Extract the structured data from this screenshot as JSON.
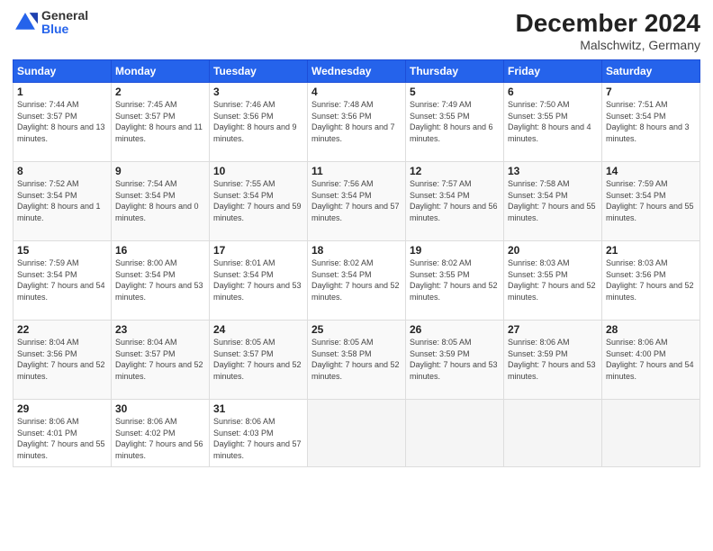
{
  "header": {
    "logo_general": "General",
    "logo_blue": "Blue",
    "month_title": "December 2024",
    "location": "Malschwitz, Germany"
  },
  "days_of_week": [
    "Sunday",
    "Monday",
    "Tuesday",
    "Wednesday",
    "Thursday",
    "Friday",
    "Saturday"
  ],
  "weeks": [
    [
      {
        "day": "1",
        "sunrise": "7:44 AM",
        "sunset": "3:57 PM",
        "daylight": "8 hours and 13 minutes."
      },
      {
        "day": "2",
        "sunrise": "7:45 AM",
        "sunset": "3:57 PM",
        "daylight": "8 hours and 11 minutes."
      },
      {
        "day": "3",
        "sunrise": "7:46 AM",
        "sunset": "3:56 PM",
        "daylight": "8 hours and 9 minutes."
      },
      {
        "day": "4",
        "sunrise": "7:48 AM",
        "sunset": "3:56 PM",
        "daylight": "8 hours and 7 minutes."
      },
      {
        "day": "5",
        "sunrise": "7:49 AM",
        "sunset": "3:55 PM",
        "daylight": "8 hours and 6 minutes."
      },
      {
        "day": "6",
        "sunrise": "7:50 AM",
        "sunset": "3:55 PM",
        "daylight": "8 hours and 4 minutes."
      },
      {
        "day": "7",
        "sunrise": "7:51 AM",
        "sunset": "3:54 PM",
        "daylight": "8 hours and 3 minutes."
      }
    ],
    [
      {
        "day": "8",
        "sunrise": "7:52 AM",
        "sunset": "3:54 PM",
        "daylight": "8 hours and 1 minute."
      },
      {
        "day": "9",
        "sunrise": "7:54 AM",
        "sunset": "3:54 PM",
        "daylight": "8 hours and 0 minutes."
      },
      {
        "day": "10",
        "sunrise": "7:55 AM",
        "sunset": "3:54 PM",
        "daylight": "7 hours and 59 minutes."
      },
      {
        "day": "11",
        "sunrise": "7:56 AM",
        "sunset": "3:54 PM",
        "daylight": "7 hours and 57 minutes."
      },
      {
        "day": "12",
        "sunrise": "7:57 AM",
        "sunset": "3:54 PM",
        "daylight": "7 hours and 56 minutes."
      },
      {
        "day": "13",
        "sunrise": "7:58 AM",
        "sunset": "3:54 PM",
        "daylight": "7 hours and 55 minutes."
      },
      {
        "day": "14",
        "sunrise": "7:59 AM",
        "sunset": "3:54 PM",
        "daylight": "7 hours and 55 minutes."
      }
    ],
    [
      {
        "day": "15",
        "sunrise": "7:59 AM",
        "sunset": "3:54 PM",
        "daylight": "7 hours and 54 minutes."
      },
      {
        "day": "16",
        "sunrise": "8:00 AM",
        "sunset": "3:54 PM",
        "daylight": "7 hours and 53 minutes."
      },
      {
        "day": "17",
        "sunrise": "8:01 AM",
        "sunset": "3:54 PM",
        "daylight": "7 hours and 53 minutes."
      },
      {
        "day": "18",
        "sunrise": "8:02 AM",
        "sunset": "3:54 PM",
        "daylight": "7 hours and 52 minutes."
      },
      {
        "day": "19",
        "sunrise": "8:02 AM",
        "sunset": "3:55 PM",
        "daylight": "7 hours and 52 minutes."
      },
      {
        "day": "20",
        "sunrise": "8:03 AM",
        "sunset": "3:55 PM",
        "daylight": "7 hours and 52 minutes."
      },
      {
        "day": "21",
        "sunrise": "8:03 AM",
        "sunset": "3:56 PM",
        "daylight": "7 hours and 52 minutes."
      }
    ],
    [
      {
        "day": "22",
        "sunrise": "8:04 AM",
        "sunset": "3:56 PM",
        "daylight": "7 hours and 52 minutes."
      },
      {
        "day": "23",
        "sunrise": "8:04 AM",
        "sunset": "3:57 PM",
        "daylight": "7 hours and 52 minutes."
      },
      {
        "day": "24",
        "sunrise": "8:05 AM",
        "sunset": "3:57 PM",
        "daylight": "7 hours and 52 minutes."
      },
      {
        "day": "25",
        "sunrise": "8:05 AM",
        "sunset": "3:58 PM",
        "daylight": "7 hours and 52 minutes."
      },
      {
        "day": "26",
        "sunrise": "8:05 AM",
        "sunset": "3:59 PM",
        "daylight": "7 hours and 53 minutes."
      },
      {
        "day": "27",
        "sunrise": "8:06 AM",
        "sunset": "3:59 PM",
        "daylight": "7 hours and 53 minutes."
      },
      {
        "day": "28",
        "sunrise": "8:06 AM",
        "sunset": "4:00 PM",
        "daylight": "7 hours and 54 minutes."
      }
    ],
    [
      {
        "day": "29",
        "sunrise": "8:06 AM",
        "sunset": "4:01 PM",
        "daylight": "7 hours and 55 minutes."
      },
      {
        "day": "30",
        "sunrise": "8:06 AM",
        "sunset": "4:02 PM",
        "daylight": "7 hours and 56 minutes."
      },
      {
        "day": "31",
        "sunrise": "8:06 AM",
        "sunset": "4:03 PM",
        "daylight": "7 hours and 57 minutes."
      },
      null,
      null,
      null,
      null
    ]
  ]
}
